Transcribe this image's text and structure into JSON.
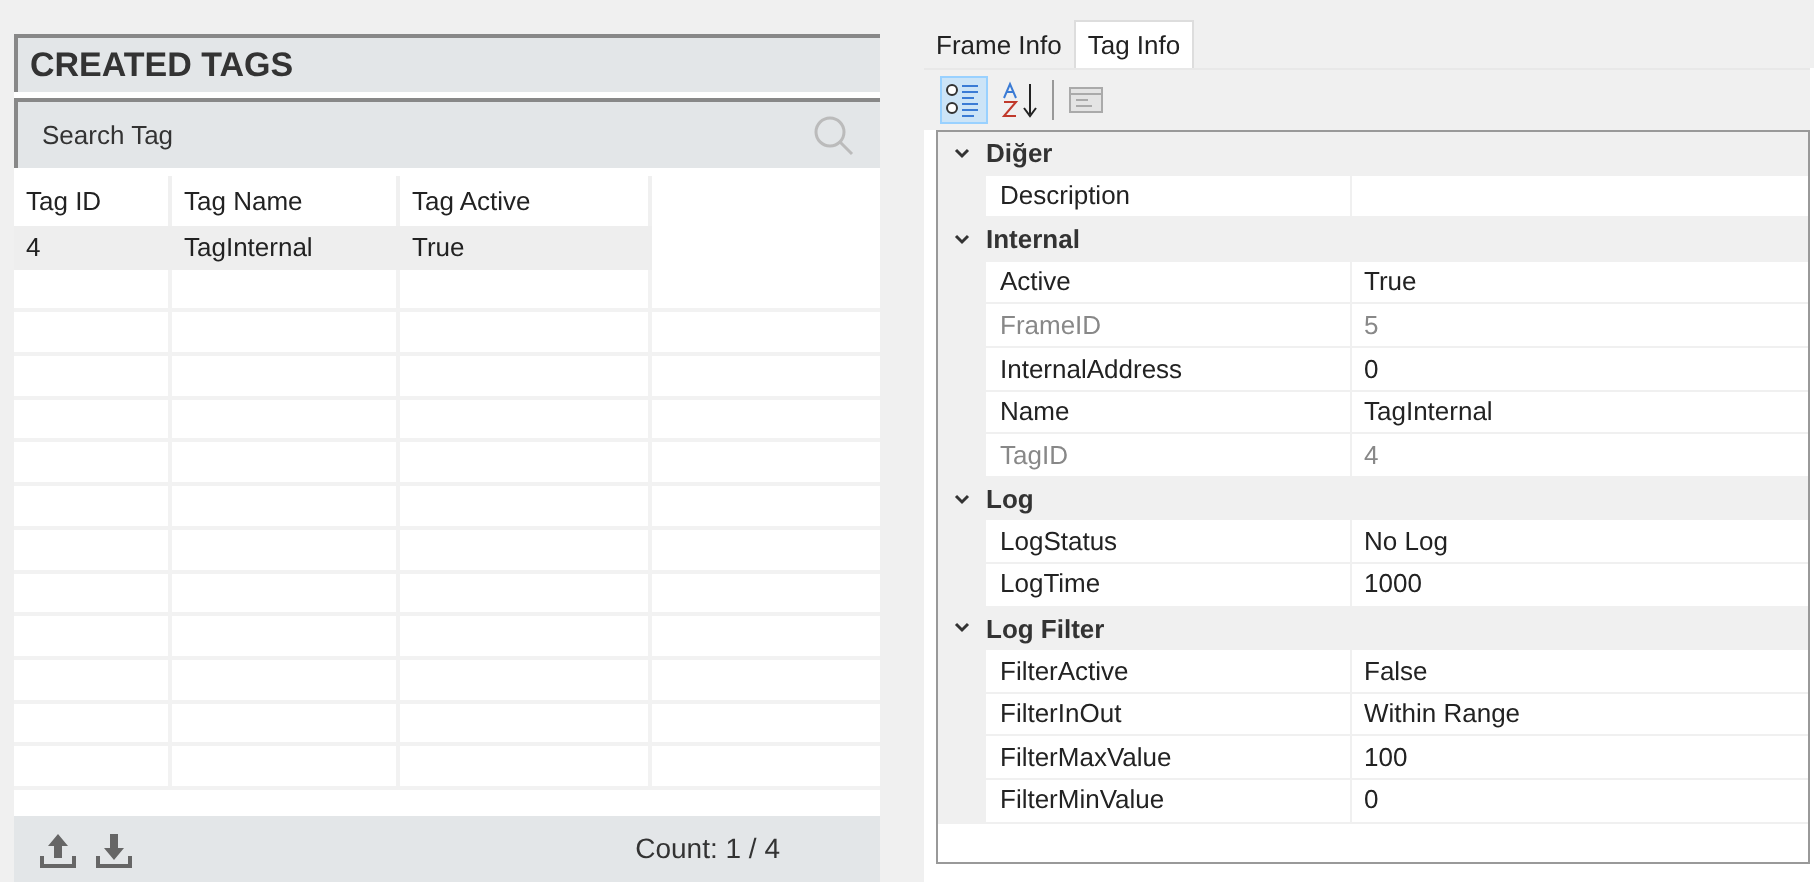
{
  "tags_panel": {
    "title": "CREATED TAGS",
    "search": {
      "placeholder": "Search Tag"
    },
    "columns": [
      "Tag ID",
      "Tag Name",
      "Tag Active"
    ],
    "rows": [
      {
        "cells": [
          "4",
          "TagInternal",
          "True"
        ],
        "selected": true
      }
    ],
    "count": "Count: 1 / 4"
  },
  "tabs": [
    {
      "label": "Frame Info",
      "selected": false
    },
    {
      "label": "Tag Info",
      "selected": true
    }
  ],
  "toolbar": [
    {
      "kind": "categorized",
      "selected": true
    },
    {
      "kind": "alphabetical",
      "selected": false
    },
    {
      "kind": "pages",
      "selected": false
    }
  ],
  "categories": [
    {
      "name": "Diğer",
      "expanded": true,
      "properties": [
        {
          "name": "Description",
          "disabled": false
        }
      ]
    },
    {
      "name": "Internal",
      "expanded": true,
      "properties": [
        {
          "name": "Active",
          "value": "True",
          "disabled": false
        },
        {
          "name": "FrameID",
          "value": "5",
          "disabled": true
        },
        {
          "name": "InternalAddress",
          "value": "0",
          "disabled": false
        },
        {
          "name": "Name",
          "value": "TagInternal",
          "disabled": false
        },
        {
          "name": "TagID",
          "value": "4",
          "disabled": true
        }
      ]
    },
    {
      "name": "Log",
      "expanded": true,
      "properties": [
        {
          "name": "LogStatus",
          "value": "No Log",
          "disabled": false
        },
        {
          "name": "LogTime",
          "value": "1000",
          "disabled": false
        }
      ]
    },
    {
      "name": "Log Filter",
      "expanded": true,
      "properties": [
        {
          "name": "FilterActive",
          "value": "False",
          "disabled": false
        },
        {
          "name": "FilterInOut",
          "value": "Within Range",
          "disabled": false
        },
        {
          "name": "FilterMaxValue",
          "value": "100",
          "disabled": false
        },
        {
          "name": "FilterMinValue",
          "value": "0",
          "disabled": false
        }
      ]
    }
  ]
}
